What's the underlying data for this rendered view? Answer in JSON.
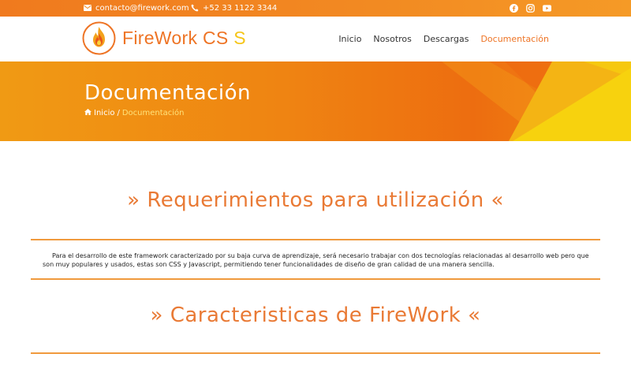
{
  "topbar": {
    "email": "contacto@firework.com",
    "phone": "+52 33 1122 3344",
    "social": [
      "facebook-icon",
      "instagram-icon",
      "youtube-icon"
    ]
  },
  "header": {
    "brand_main": "FireWork CS",
    "brand_accent": "S",
    "nav": [
      {
        "label": "Inicio",
        "active": false
      },
      {
        "label": "Nosotros",
        "active": false
      },
      {
        "label": "Descargas",
        "active": false
      },
      {
        "label": "Documentación",
        "active": true
      }
    ]
  },
  "banner": {
    "title": "Documentación",
    "breadcrumb_home": "Inicio",
    "breadcrumb_sep": "/",
    "breadcrumb_current": "Documentación"
  },
  "sections": {
    "requirements_title": "» Requerimientos para utilización «",
    "requirements_text": "Para el desarrollo de este framework caracterizado por su baja curva de aprendizaje, será necesario trabajar con dos tecnologías relacionadas al desarrollo web pero que son muy populares y usados, estas son CSS y Javascript, permitiendo tener funcionalidades de diseño de gran calidad de una manera sencilla.",
    "features_title": "» Caracteristicas de FireWork «"
  },
  "colors": {
    "brand_orange": "#ee7425",
    "accent_yellow": "#f5c518",
    "rule": "#f09a3d"
  }
}
